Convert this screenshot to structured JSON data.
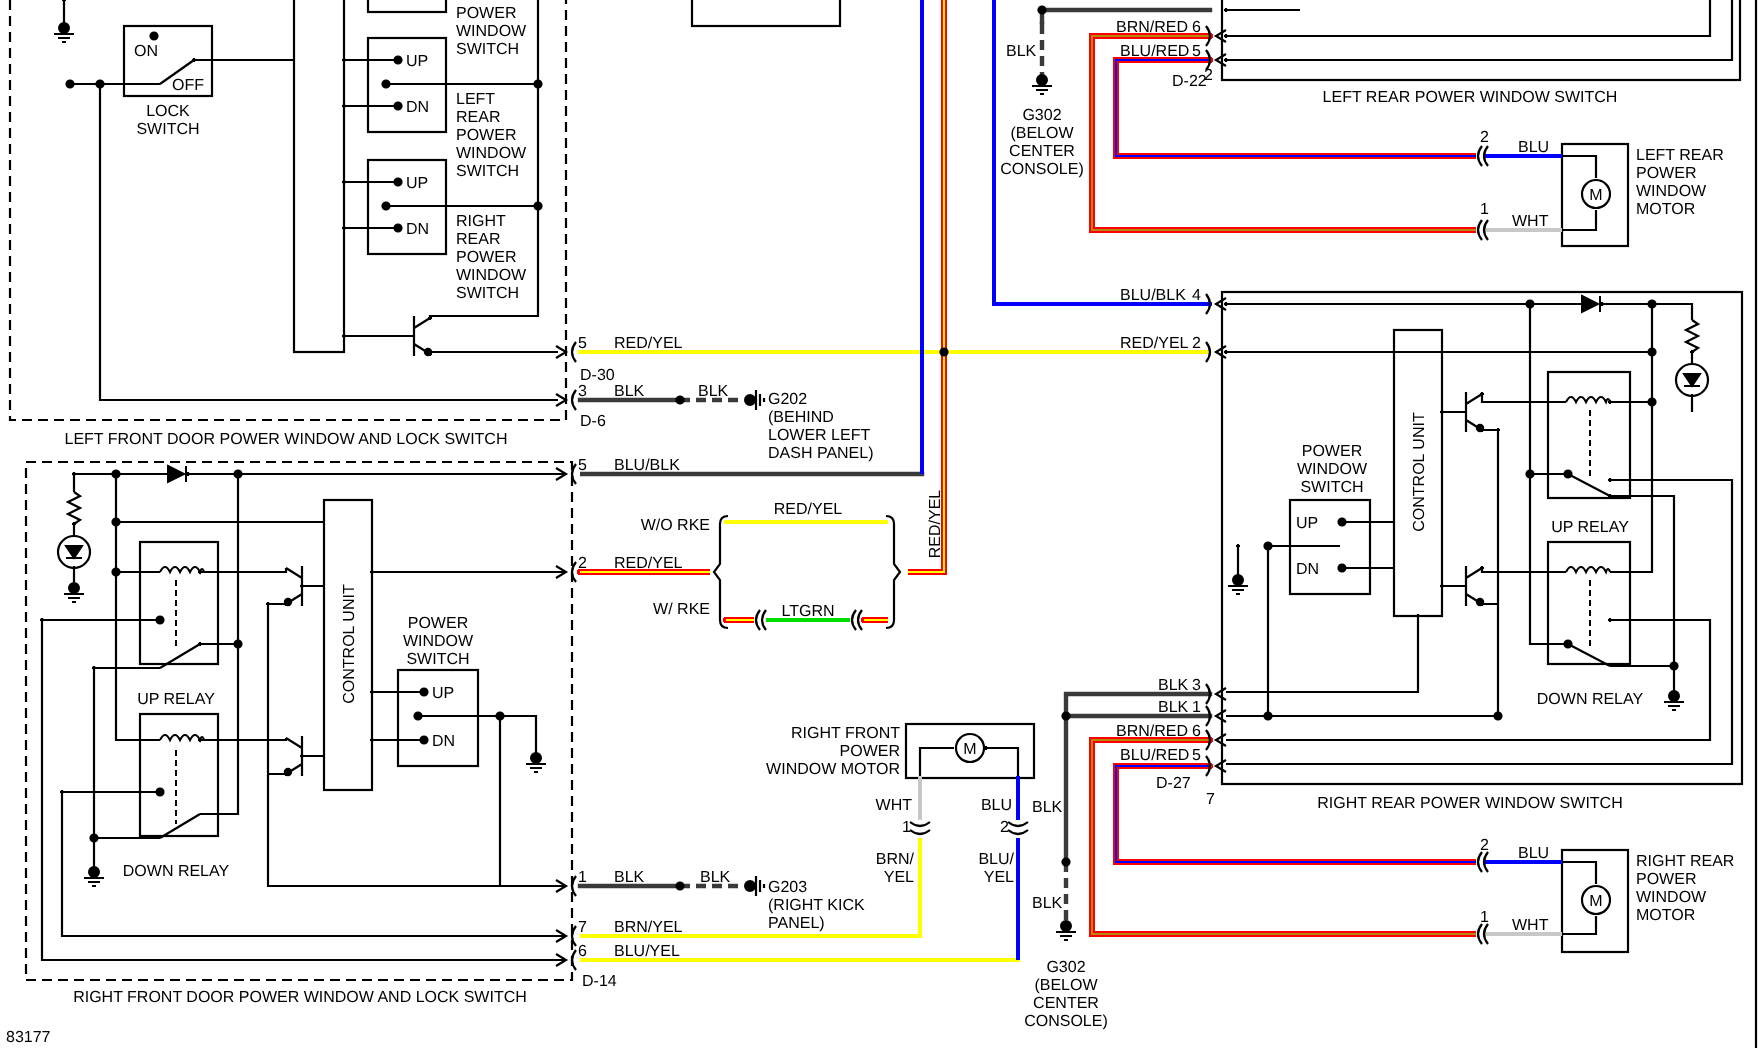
{
  "component_captions": [
    {
      "lines": [
        "LOCK",
        "SWITCH"
      ]
    },
    {
      "lines": [
        "POWER",
        "WINDOW",
        "SWITCH"
      ]
    },
    {
      "lines": [
        "LEFT",
        "REAR",
        "POWER",
        "WINDOW",
        "SWITCH"
      ]
    },
    {
      "lines": [
        "RIGHT",
        "REAR",
        "POWER",
        "WINDOW",
        "SWITCH"
      ]
    },
    {
      "text": "LEFT FRONT DOOR POWER WINDOW AND LOCK SWITCH"
    },
    {
      "text": "LEFT REAR POWER WINDOW SWITCH"
    },
    {
      "lines": [
        "LEFT REAR",
        "POWER",
        "WINDOW",
        "MOTOR"
      ]
    },
    {
      "lines": [
        "POWER",
        "WINDOW",
        "SWITCH"
      ]
    },
    {
      "text": "CONTROL UNIT"
    },
    {
      "text": "UP RELAY"
    },
    {
      "text": "DOWN RELAY"
    },
    {
      "text": "RIGHT REAR POWER WINDOW SWITCH"
    },
    {
      "lines": [
        "RIGHT REAR",
        "POWER",
        "WINDOW",
        "MOTOR"
      ]
    },
    {
      "text": "UP RELAY"
    },
    {
      "text": "DOWN RELAY"
    },
    {
      "text": "CONTROL UNIT"
    },
    {
      "lines": [
        "POWER",
        "WINDOW",
        "SWITCH"
      ]
    },
    {
      "text": "RIGHT FRONT DOOR POWER WINDOW AND LOCK SWITCH"
    },
    {
      "lines": [
        "RIGHT FRONT",
        "POWER",
        "WINDOW MOTOR"
      ]
    },
    {
      "text": "W/O RKE"
    },
    {
      "text": "W/ RKE"
    }
  ],
  "switch_positions": [
    {
      "text": "ON"
    },
    {
      "text": "OFF"
    },
    {
      "text": "UP"
    },
    {
      "text": "DN"
    },
    {
      "text": "UP"
    },
    {
      "text": "DN"
    },
    {
      "text": "UP"
    },
    {
      "text": "DN"
    },
    {
      "text": "UP"
    },
    {
      "text": "DN"
    }
  ],
  "wire_labels": [
    {
      "text": "RED/YEL"
    },
    {
      "text": "BLK"
    },
    {
      "text": "BLK"
    },
    {
      "text": "BLK"
    },
    {
      "text": "BRN/RED"
    },
    {
      "text": "BLU/RED"
    },
    {
      "text": "BLU/BLK"
    },
    {
      "text": "RED/YEL"
    },
    {
      "text": "BLU"
    },
    {
      "text": "WHT"
    },
    {
      "text": "BLU/BLK"
    },
    {
      "text": "RED/YEL"
    },
    {
      "text": "RED/YEL"
    },
    {
      "text": "RED/YEL"
    },
    {
      "text": "LTGRN"
    },
    {
      "text": "BLK"
    },
    {
      "text": "BLK"
    },
    {
      "text": "BRN/RED"
    },
    {
      "text": "BLU/RED"
    },
    {
      "text": "WHT"
    },
    {
      "text": "BLU"
    },
    {
      "text": "BLK"
    },
    {
      "lines": [
        "BRN/",
        "YEL"
      ]
    },
    {
      "lines": [
        "BLU/",
        "YEL"
      ]
    },
    {
      "text": "BLK"
    },
    {
      "text": "BLK"
    },
    {
      "text": "BLK"
    },
    {
      "text": "BRN/YEL"
    },
    {
      "text": "BLU/YEL"
    },
    {
      "text": "BLU"
    },
    {
      "text": "WHT"
    }
  ],
  "pin_numbers": [
    {
      "text": "5"
    },
    {
      "text": "3"
    },
    {
      "text": "6"
    },
    {
      "text": "5"
    },
    {
      "text": "2"
    },
    {
      "text": "4"
    },
    {
      "text": "2"
    },
    {
      "text": "2"
    },
    {
      "text": "1"
    },
    {
      "text": "5"
    },
    {
      "text": "2"
    },
    {
      "text": "3"
    },
    {
      "text": "1"
    },
    {
      "text": "6"
    },
    {
      "text": "5"
    },
    {
      "text": "7"
    },
    {
      "text": "1"
    },
    {
      "text": "2"
    },
    {
      "text": "1"
    },
    {
      "text": "7"
    },
    {
      "text": "6"
    },
    {
      "text": "2"
    },
    {
      "text": "1"
    }
  ],
  "connector_ids": [
    {
      "text": "D-30"
    },
    {
      "text": "D-6"
    },
    {
      "text": "D-22"
    },
    {
      "text": "D-27"
    },
    {
      "text": "D-14"
    }
  ],
  "ground_labels": [
    {
      "lines": [
        "G202",
        "(BEHIND",
        "LOWER LEFT",
        "DASH PANEL)"
      ]
    },
    {
      "lines": [
        "G302",
        "(BELOW",
        "CENTER",
        "CONSOLE)"
      ]
    },
    {
      "lines": [
        "G203",
        "(RIGHT KICK",
        "PANEL)"
      ]
    },
    {
      "lines": [
        "G302",
        "(BELOW",
        "CENTER",
        "CONSOLE)"
      ]
    }
  ],
  "motor_marks": [
    {
      "text": "M"
    },
    {
      "text": "M"
    },
    {
      "text": "M"
    }
  ],
  "figure_number": "83177"
}
